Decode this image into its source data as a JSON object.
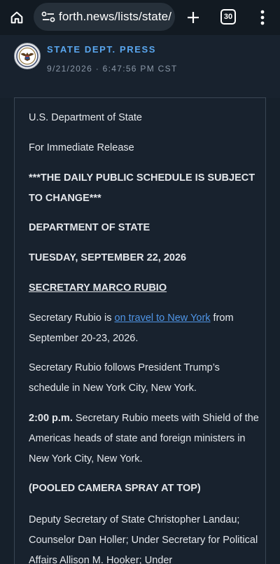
{
  "browser": {
    "url": "forth.news/lists/state/",
    "tab_count": "30"
  },
  "post": {
    "author": "STATE DEPT. PRESS",
    "timestamp": "9/21/2026 · 6:47:56 PM CST"
  },
  "content": {
    "line_dept": "U.S. Department of State",
    "line_release": "For Immediate Release",
    "line_subject": "***THE DAILY PUBLIC SCHEDULE IS SUBJECT TO CHANGE***",
    "line_department": "DEPARTMENT OF STATE",
    "line_date": "TUESDAY, SEPTEMBER 22, 2026",
    "line_secretary": "SECRETARY MARCO RUBIO",
    "travel_before": "Secretary Rubio is ",
    "travel_link": "on travel to New York",
    "travel_after": " from September 20-23, 2026.",
    "follows": " Secretary Rubio follows President Trump’s schedule in New York City, New York.",
    "meeting_time": "2:00 p.m.",
    "meeting_text": " Secretary Rubio meets with Shield of the Americas heads of state and foreign ministers in New York City, New York.",
    "pooled": "(POOLED CAMERA SPRAY AT TOP)",
    "deputy": "Deputy Secretary of State Christopher Landau; Counselor Dan Holler; Under Secretary for Political Affairs Allison M. Hooker; Under"
  },
  "colors": {
    "background": "#16202b",
    "author": "#5aa7ef",
    "link": "#4f95e6"
  },
  "icons": [
    "home-icon",
    "site-settings-icon",
    "plus-icon",
    "tab-switcher-icon",
    "more-vert-icon",
    "state-seal-icon"
  ]
}
